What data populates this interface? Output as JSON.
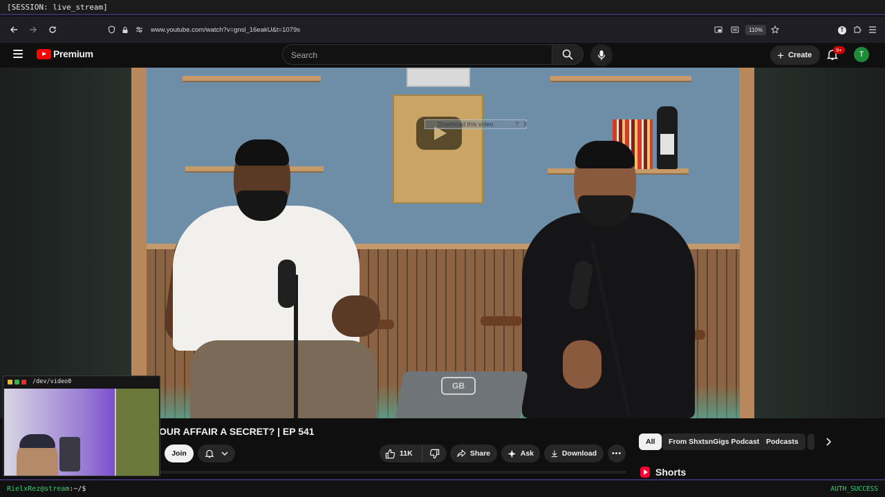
{
  "session": {
    "label": "[SESSION: live_stream]"
  },
  "browser": {
    "url": "www.youtube.com/watch?v=gnsl_16eakU&t=1079s",
    "zoom": "110%"
  },
  "header": {
    "brand": "Premium",
    "search_placeholder": "Search",
    "create_label": "Create",
    "notification_count": "9+",
    "avatar_letter": "T"
  },
  "video": {
    "overlay_text": "Download this video",
    "overlay_help": "?",
    "overlay_close": "X",
    "tablet_logo": "GB"
  },
  "below": {
    "title": "OUR AFFAIR A SECRET? | EP 541",
    "join_label": "Join",
    "like_count": "11K",
    "share_label": "Share",
    "ask_label": "Ask",
    "download_label": "Download",
    "more_label": "•••"
  },
  "chips": [
    {
      "label": "All"
    },
    {
      "label": "From ShxtsnGigs Podcast"
    },
    {
      "label": "Podcasts"
    }
  ],
  "shorts": {
    "label": "Shorts"
  },
  "webcam": {
    "device": "/dev/video0"
  },
  "terminal": {
    "prompt_user": "RielxRez@stream",
    "prompt_path": ":~/$",
    "status": "AUTH_SUCCESS"
  },
  "colors": {
    "accent_purple": "#3b2f66",
    "youtube_red": "#ff0000",
    "terminal_green": "#35d27a",
    "avatar_green": "#1e8b3a"
  }
}
